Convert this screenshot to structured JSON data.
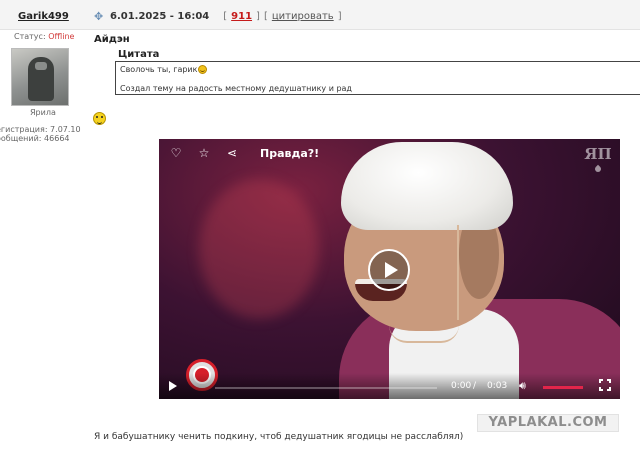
{
  "post": {
    "username": "Garik499",
    "date": "6.01.2025 - 16:04",
    "rating_open": "[",
    "rating": "911",
    "rating_close": "]",
    "quote_open": "[",
    "quote_link": "цитировать",
    "quote_close": "]",
    "author_tag": "Айдэн",
    "body_text": "Я и бабушатнику ченить подкину, чтоб дедушатник ягодицы не расслаблял)"
  },
  "user": {
    "status_label": "Статус:",
    "status_value": "Offline",
    "avatar_caption": "Ярила",
    "reg_line": "егистрация: 7.07.10",
    "messages_line": "ообщений: 46664"
  },
  "quote": {
    "title": "Цитата",
    "line1": "Сволочь ты, гарик",
    "line2": "Создал тему на радость местному дедушатнику и рад"
  },
  "video": {
    "title": "Правда?!",
    "logo": "ЯП",
    "time_current": "0:00",
    "time_sep": "/",
    "time_duration": "0:03",
    "progress": 0,
    "volume": 1.0,
    "icons": [
      "heart-icon",
      "star-icon",
      "share-icon",
      "play-icon",
      "volume-icon",
      "fullscreen-icon"
    ]
  },
  "watermark": "YAPLAKAL.COM",
  "colors": {
    "accent_red": "#c51b1b",
    "video_accent": "#e1254a",
    "offline": "#d23c3c"
  }
}
